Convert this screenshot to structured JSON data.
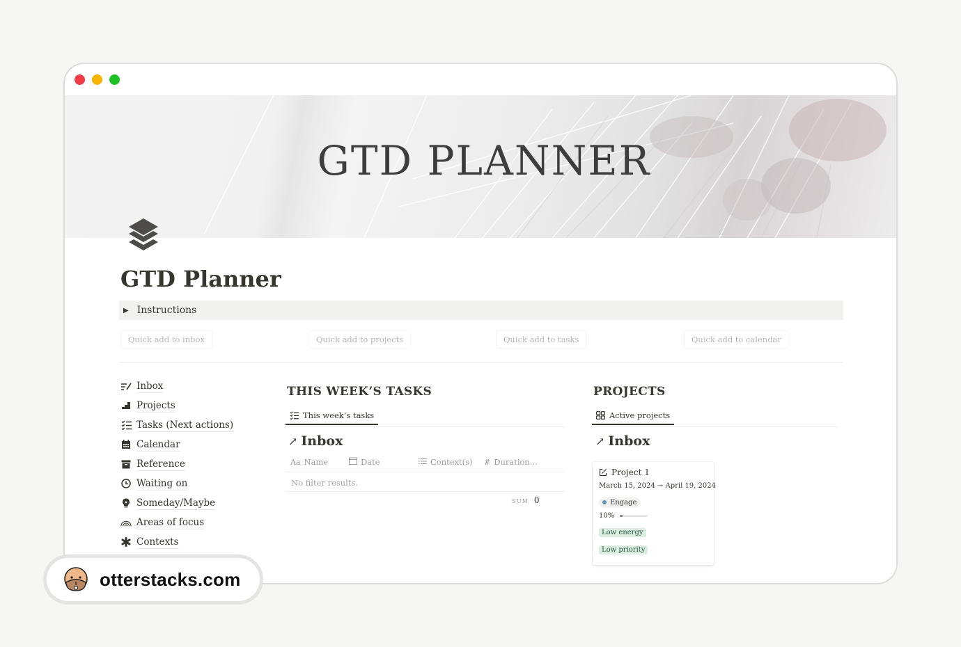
{
  "window": {
    "controls": [
      "close",
      "minimize",
      "maximize"
    ]
  },
  "cover": {
    "title": "GTD PLANNER"
  },
  "page": {
    "icon": "stacked-layers-icon",
    "title": "GTD Planner"
  },
  "toggle": {
    "label": "Instructions",
    "state": "collapsed"
  },
  "quick_add": [
    {
      "label": "Quick add to inbox"
    },
    {
      "label": "Quick add to projects"
    },
    {
      "label": "Quick add to tasks"
    },
    {
      "label": "Quick add to calendar"
    }
  ],
  "nav": [
    {
      "label": "Inbox",
      "icon": "inbox-pen-icon"
    },
    {
      "label": "Projects",
      "icon": "stairs-icon"
    },
    {
      "label": "Tasks (Next actions)",
      "icon": "checklist-icon"
    },
    {
      "label": "Calendar",
      "icon": "calendar-icon"
    },
    {
      "label": "Reference",
      "icon": "archive-icon"
    },
    {
      "label": "Waiting on",
      "icon": "clock-icon"
    },
    {
      "label": "Someday/Maybe",
      "icon": "lightbulb-icon"
    },
    {
      "label": "Areas of focus",
      "icon": "rainbow-icon"
    },
    {
      "label": "Contexts",
      "icon": "asterisk-icon"
    }
  ],
  "tasks_section": {
    "heading": "THIS WEEK’S TASKS",
    "view_tab": "This week’s tasks",
    "db_title": "Inbox",
    "db_arrow": "↗",
    "columns": [
      {
        "label": "Name",
        "icon": "Aa"
      },
      {
        "label": "Date",
        "icon": "calendar-icon"
      },
      {
        "label": "Context(s)",
        "icon": "list-icon"
      },
      {
        "label": "Duration...",
        "icon": "#"
      }
    ],
    "empty_text": "No filter results.",
    "sum_label": "SUM",
    "sum_value": "0"
  },
  "projects_section": {
    "heading": "PROJECTS",
    "view_tab": "Active projects",
    "db_title": "Inbox",
    "db_arrow": "↗",
    "cards": [
      {
        "title": "Project 1",
        "dates": "March 15, 2024 → April 19, 2024",
        "status": "Engage",
        "status_color": "#5b8fb9",
        "progress_label": "10%",
        "progress": 0.1,
        "tags": [
          "Low energy",
          "Low priority"
        ]
      }
    ]
  },
  "watermark": {
    "text": "otterstacks.com"
  },
  "colors": {
    "background": "#f6f6f5",
    "text": "#37352f",
    "tag_green_bg": "#dbede1",
    "close": "#ee3b46",
    "minimize": "#f4b400",
    "maximize": "#1ec125"
  }
}
